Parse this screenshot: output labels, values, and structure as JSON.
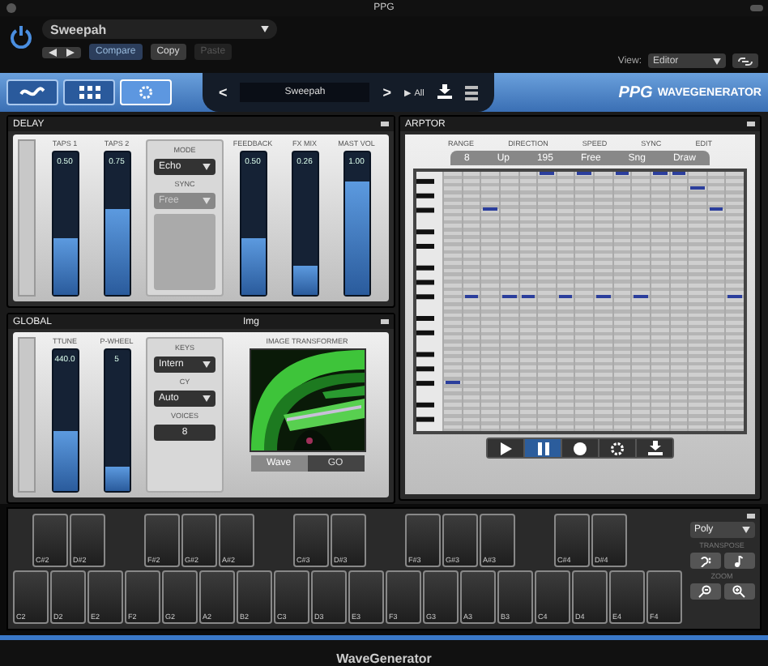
{
  "window": {
    "title": "PPG"
  },
  "host": {
    "preset": "Sweepah",
    "buttons": [
      {
        "label": "Compare",
        "selected": true,
        "disabled": false
      },
      {
        "label": "Copy",
        "selected": false,
        "disabled": false
      },
      {
        "label": "Paste",
        "selected": false,
        "disabled": true
      }
    ],
    "view_label": "View:",
    "view": "Editor"
  },
  "toolbar": {
    "pages": [
      {
        "kind": "wave",
        "selected": false
      },
      {
        "kind": "grid",
        "selected": false
      },
      {
        "kind": "gear",
        "selected": true
      }
    ],
    "prev": "<",
    "preset": "Sweepah",
    "next": ">",
    "all": "▶ All",
    "logo": "PPG",
    "product": "WAVEGENERATOR"
  },
  "delay": {
    "title": "DELAY",
    "faders_left": [
      {
        "label": "TAPS 1",
        "value": "0.50",
        "level": 0.4
      },
      {
        "label": "TAPS 2",
        "value": "0.75",
        "level": 0.6
      }
    ],
    "selects": [
      {
        "label": "MODE",
        "value": "Echo",
        "disabled": false
      },
      {
        "label": "SYNC",
        "value": "Free",
        "disabled": true
      }
    ],
    "faders_right": [
      {
        "label": "FEEDBACK",
        "value": "0.50",
        "level": 0.4
      },
      {
        "label": "FX MIX",
        "value": "0.26",
        "level": 0.2
      },
      {
        "label": "MAST VOL",
        "value": "1.00",
        "level": 0.8
      }
    ]
  },
  "global": {
    "title": "GLOBAL",
    "tab": "Img",
    "faders": [
      {
        "label": "TTUNE",
        "value": "440.0",
        "level": 0.42
      },
      {
        "label": "P-WHEEL",
        "value": "5",
        "level": 0.17
      }
    ],
    "selects": [
      {
        "label": "KEYS",
        "value": "Intern"
      },
      {
        "label": "CY",
        "value": "Auto"
      }
    ],
    "voices": {
      "label": "VOICES",
      "value": "8"
    },
    "transformer": {
      "title": "IMAGE TRANSFORMER",
      "buttons": [
        {
          "label": "Wave",
          "selected": true
        },
        {
          "label": "GO",
          "selected": false
        }
      ]
    }
  },
  "arptor": {
    "title": "ARPTOR",
    "labels": [
      "RANGE",
      "DIRECTION",
      "SPEED",
      "SYNC",
      "EDIT"
    ],
    "values": [
      "8",
      "Up",
      "195",
      "Free",
      "Sng",
      "Draw"
    ],
    "steps": [
      {
        "level": 0.17
      },
      {
        "level": 0.51
      },
      {
        "level": 0.86
      },
      {
        "level": 0.51
      },
      {
        "level": 0.51
      },
      {
        "level": 1
      },
      {
        "level": 0.51
      },
      {
        "level": 1
      },
      {
        "level": 0.51
      },
      {
        "level": 1
      },
      {
        "level": 0.51
      },
      {
        "level": 1
      },
      {
        "level": 1
      },
      {
        "level": 0.94
      },
      {
        "level": 0.86
      },
      {
        "level": 0.51
      }
    ],
    "transport": [
      {
        "kind": "play",
        "selected": false
      },
      {
        "kind": "pause",
        "selected": true
      },
      {
        "kind": "record",
        "selected": false
      },
      {
        "kind": "gear",
        "selected": false
      },
      {
        "kind": "download",
        "selected": false
      }
    ]
  },
  "keyboard": {
    "black_keys": [
      {
        "kind": "key",
        "label": "C#2"
      },
      {
        "kind": "key",
        "label": "D#2"
      },
      {
        "kind": "gap"
      },
      {
        "kind": "key",
        "label": "F#2"
      },
      {
        "kind": "key",
        "label": "G#2"
      },
      {
        "kind": "key",
        "label": "A#2"
      },
      {
        "kind": "gap"
      },
      {
        "kind": "key",
        "label": "C#3"
      },
      {
        "kind": "key",
        "label": "D#3"
      },
      {
        "kind": "gap"
      },
      {
        "kind": "key",
        "label": "F#3"
      },
      {
        "kind": "key",
        "label": "G#3"
      },
      {
        "kind": "key",
        "label": "A#3"
      },
      {
        "kind": "gap"
      },
      {
        "kind": "key",
        "label": "C#4"
      },
      {
        "kind": "key",
        "label": "D#4"
      }
    ],
    "white_keys": [
      "C2",
      "D2",
      "E2",
      "F2",
      "G2",
      "A2",
      "B2",
      "C3",
      "D3",
      "E3",
      "F3",
      "G3",
      "A3",
      "B3",
      "C4",
      "D4",
      "E4",
      "F4"
    ],
    "mode": "Poly",
    "transpose_label": "TRANSPOSE",
    "zoom_label": "ZOOM"
  },
  "footer": {
    "title": "WaveGenerator"
  }
}
